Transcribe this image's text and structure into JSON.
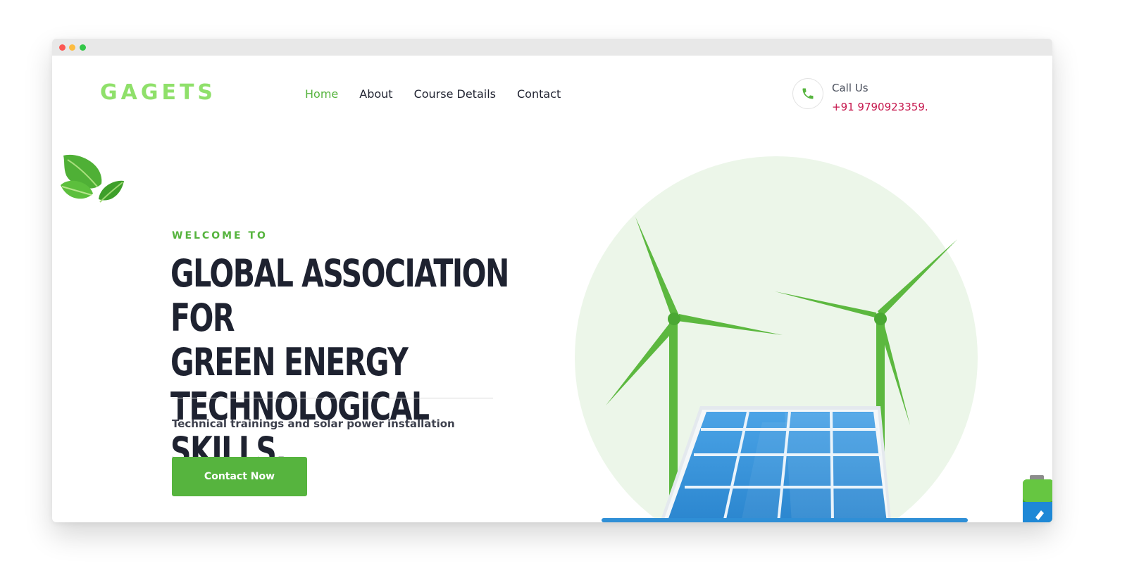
{
  "brand": {
    "logo_text": "GAGETS",
    "accent_color": "#56b43e",
    "logo_color": "#8fe06a"
  },
  "nav": {
    "items": [
      {
        "label": "Home",
        "active": true
      },
      {
        "label": "About",
        "active": false
      },
      {
        "label": "Course Details",
        "active": false
      },
      {
        "label": "Contact",
        "active": false
      }
    ]
  },
  "call": {
    "label": "Call Us",
    "number": "+91 9790923359.",
    "icon": "phone-icon",
    "number_color": "#c6174d"
  },
  "hero": {
    "eyebrow": "WELCOME TO",
    "title_lines": [
      "GLOBAL ASSOCIATION FOR",
      "GREEN ENERGY",
      "TECHNOLOGICAL SKILLS."
    ],
    "subtitle": "Technical trainings and solar power installation",
    "cta_label": "Contact Now"
  },
  "icons": {
    "decor": [
      "leaves-icon",
      "wind-turbine-icon",
      "solar-panel-icon",
      "battery-icon"
    ]
  }
}
